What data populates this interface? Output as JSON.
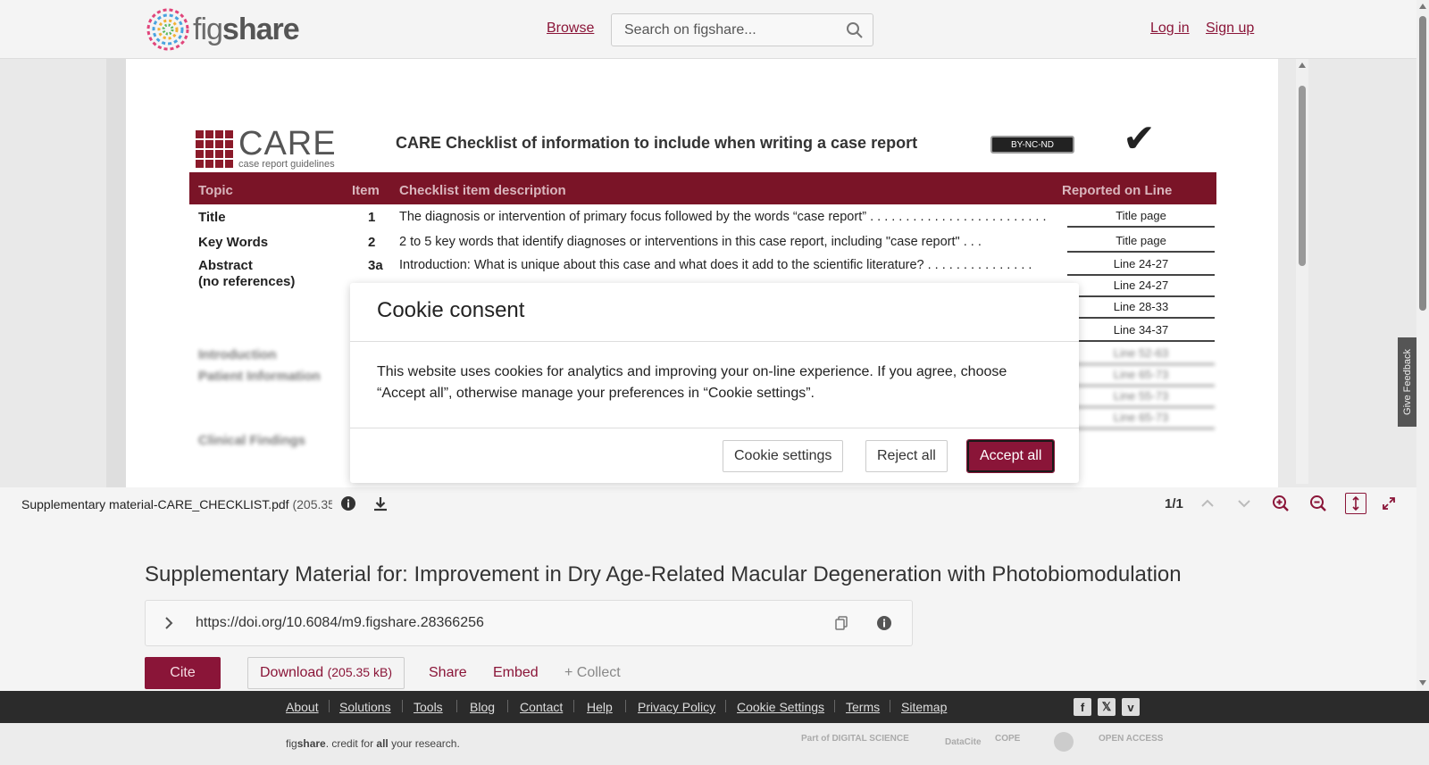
{
  "header": {
    "logo_text_light": "fig",
    "logo_text_bold": "share",
    "browse": "Browse",
    "search_placeholder": "Search on figshare...",
    "login": "Log in",
    "signup": "Sign up"
  },
  "document": {
    "care_word": "CARE",
    "care_sub": "case report guidelines",
    "title": "CARE Checklist of information to include when writing a case report",
    "license": "BY-NC-ND",
    "checkmark": "✔",
    "columns": {
      "topic": "Topic",
      "item": "Item",
      "desc": "Checklist item description",
      "reported": "Reported on Line"
    },
    "rows": [
      {
        "topic": "Title",
        "item": "1",
        "desc": "The diagnosis or intervention of primary focus followed by the words “case report” . . . . . . . . . . . . . . . . . . . . . . . . .",
        "reported": "Title page"
      },
      {
        "topic": "Key Words",
        "item": "2",
        "desc": "2 to 5 key words that identify diagnoses or interventions in this case report, including \"case report\" . . .",
        "reported": "Title page"
      },
      {
        "topic": "Abstract",
        "topic2": "(no references)",
        "item": "3a",
        "desc": "Introduction: What is unique about this case and what does it add to the scientific literature? . . . . . . . . . . . . . . .",
        "reported": "Line 24-27"
      }
    ],
    "extra_reported": [
      "Line 24-27",
      "Line 28-33",
      "Line 34-37",
      "Line 52-63",
      "Line 65-73",
      "Line 55-73",
      "Line 65-73"
    ],
    "blurred_topics": [
      "Introduction",
      "Patient Information",
      "Clinical Findings"
    ]
  },
  "viewer": {
    "filename": "Supplementary material-CARE_CHECKLIST.pdf",
    "filesize": "(205.35",
    "page_indicator": "1/1"
  },
  "item": {
    "title": "Supplementary Material for: Improvement in Dry Age-Related Macular Degeneration with Photobiomodulation",
    "doi": "https://doi.org/10.6084/m9.figshare.28366256",
    "cite": "Cite",
    "download": "Download",
    "download_size": "(205.35 kB)",
    "share": "Share",
    "embed": "Embed",
    "collect": "+ Collect"
  },
  "feedback": "Give Feedback",
  "footer": {
    "links": [
      "About",
      "Solutions",
      "Tools",
      "Blog",
      "Contact",
      "Help",
      "Privacy Policy",
      "Cookie Settings",
      "Terms",
      "Sitemap"
    ],
    "tagline_pre": "fig",
    "tagline_bold": "share",
    "tagline_mid": ". credit for ",
    "tagline_all": "all",
    "tagline_end": " your research.",
    "partners": [
      "Part of DIGITAL SCIENCE",
      "DataCite",
      "COPE",
      "OPEN ACCESS"
    ]
  },
  "cookie": {
    "title": "Cookie consent",
    "text": "This website uses cookies for analytics and improving your on-line experience. If you agree, choose “Accept all”, otherwise manage your preferences in “Cookie settings”.",
    "settings": "Cookie settings",
    "reject": "Reject all",
    "accept": "Accept all"
  },
  "colors": {
    "brand": "#8a1538",
    "care_red": "#7a1427",
    "footer_dark": "#2b2b2b"
  }
}
